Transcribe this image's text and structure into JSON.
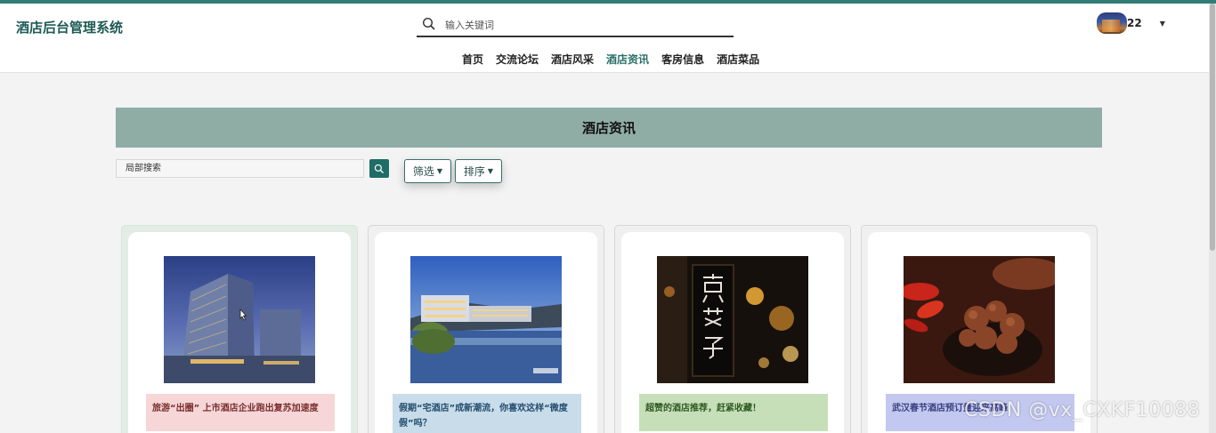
{
  "header": {
    "brand": "酒店后台管理系统",
    "search_placeholder": "输入关键词",
    "username": "22"
  },
  "nav": {
    "items": [
      {
        "label": "首页"
      },
      {
        "label": "交流论坛"
      },
      {
        "label": "酒店风采"
      },
      {
        "label": "酒店资讯",
        "active": true
      },
      {
        "label": "客房信息"
      },
      {
        "label": "酒店菜品"
      }
    ]
  },
  "page": {
    "title": "酒店资讯",
    "local_search_placeholder": "局部搜索",
    "filter_label": "筛选",
    "sort_label": "排序"
  },
  "cards": [
    {
      "caption": "旅游“出圈” 上市酒店企业跑出复苏加速度",
      "caption_bg": "#f6d6d6",
      "image": "hotel-tower-night"
    },
    {
      "caption": "假期“宅酒店”成新潮流，你喜欢这样“微度假”吗？",
      "caption_bg": "#c8dcea",
      "image": "resort-lake-dusk"
    },
    {
      "caption": "超赞的酒店推荐，赶紧收藏！",
      "caption_bg": "#c6dfb9",
      "image": "alley-lantern-sign"
    },
    {
      "caption": "武汉春节酒店预订量迎来高峰",
      "caption_bg": "#c2c8ef",
      "image": "braised-meat-chili"
    }
  ],
  "watermark": "CSDN @vx_CXKF10088"
}
